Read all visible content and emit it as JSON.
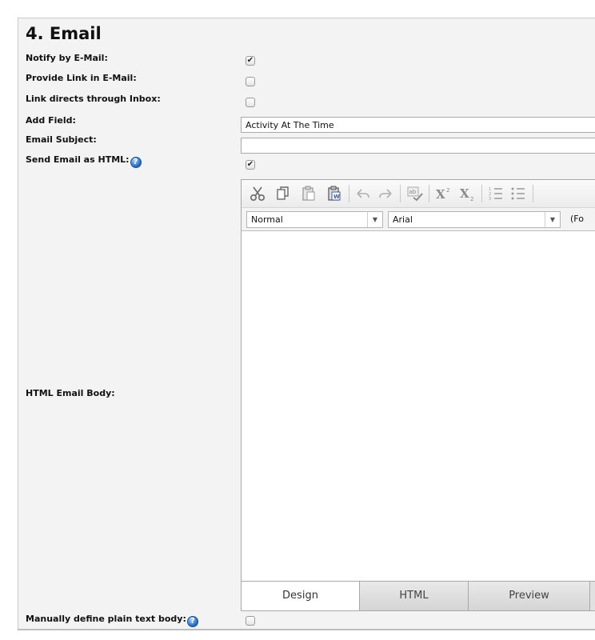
{
  "section": {
    "title": "4. Email"
  },
  "fields": {
    "notify_email": {
      "label": "Notify by E-Mail:",
      "checked": true
    },
    "provide_link": {
      "label": "Provide Link in E-Mail:",
      "checked": false
    },
    "link_inbox": {
      "label": "Link directs through Inbox:",
      "checked": false
    },
    "add_field": {
      "label": "Add Field:",
      "value": "Activity At The Time"
    },
    "email_subject": {
      "label": "Email Subject:",
      "value": ""
    },
    "send_html": {
      "label": "Send Email as HTML:",
      "checked": true
    },
    "html_body": {
      "label": "HTML Email Body:"
    },
    "plain_text": {
      "label": "Manually define plain text body:",
      "checked": false
    }
  },
  "editor": {
    "toolbar_icons": [
      "cut-icon",
      "copy-icon",
      "paste-icon",
      "paste-from-word-icon",
      "undo-icon",
      "redo-icon",
      "spellcheck-icon",
      "superscript-icon",
      "subscript-icon",
      "ordered-list-icon",
      "unordered-list-icon"
    ],
    "paragraph_format": "Normal",
    "font_name": "Arial",
    "font_size_partial": "(Fo",
    "modes": [
      "Design",
      "HTML",
      "Preview"
    ],
    "active_mode": "Design"
  },
  "icons": {
    "checkmark": "✔",
    "help": "?",
    "dropdown": "▼"
  }
}
